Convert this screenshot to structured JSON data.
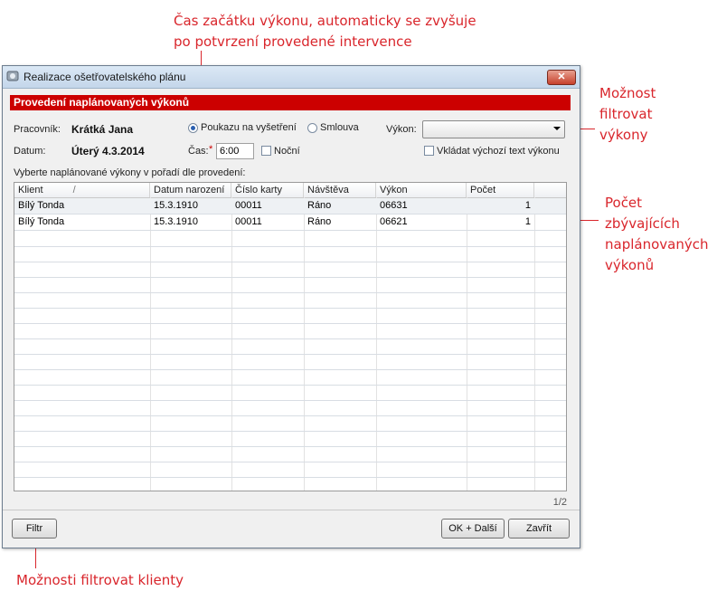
{
  "annotations": {
    "time_note_line1": "Čas začátku výkonu, automaticky se zvyšuje",
    "time_note_line2": "po potvrzení provedené intervence",
    "filter_vykon_line1": "Možnost",
    "filter_vykon_line2": "filtrovat",
    "filter_vykon_line3": "výkony",
    "count_line1": "Počet",
    "count_line2": "zbývajících",
    "count_line3": "naplánovaných",
    "count_line4": "výkonů",
    "filter_clients": "Možnosti filtrovat klienty"
  },
  "window": {
    "title": "Realizace ošetřovatelského plánu",
    "close_label": "✕"
  },
  "section_title": "Provedení naplánovaných výkonů",
  "form": {
    "worker_label": "Pracovník:",
    "worker_value": "Krátká Jana",
    "date_label": "Datum:",
    "date_value": "Úterý 4.3.2014",
    "radio_referral_label": "Poukazu na vyšetření",
    "radio_contract_label": "Smlouva",
    "radio_selected": "referral",
    "time_label": "Čas:",
    "required_mark": "*",
    "time_value": "6:00",
    "night_label": "Noční",
    "vykon_label": "Výkon:",
    "vykon_value": "",
    "insert_text_label": "Vkládat výchozí text výkonu",
    "list_caption": "Vyberte naplánované výkony v pořadí dle provedení:"
  },
  "table": {
    "columns": [
      "Klient",
      "Datum narození",
      "Číslo karty",
      "Návštěva",
      "Výkon",
      "Počet"
    ],
    "sort_indicator": "/",
    "rows": [
      [
        "Bílý Tonda",
        "15.3.1910",
        "00011",
        "Ráno",
        "06631",
        "1"
      ],
      [
        "Bílý Tonda",
        "15.3.1910",
        "00011",
        "Ráno",
        "06621",
        "1"
      ]
    ]
  },
  "footer": {
    "page_indicator": "1/2",
    "filter_button": "Filtr",
    "ok_next_button": "OK + Další",
    "close_button": "Zavřít"
  },
  "colors": {
    "accent_red": "#cc0000",
    "annotation_red": "#d9262c"
  }
}
